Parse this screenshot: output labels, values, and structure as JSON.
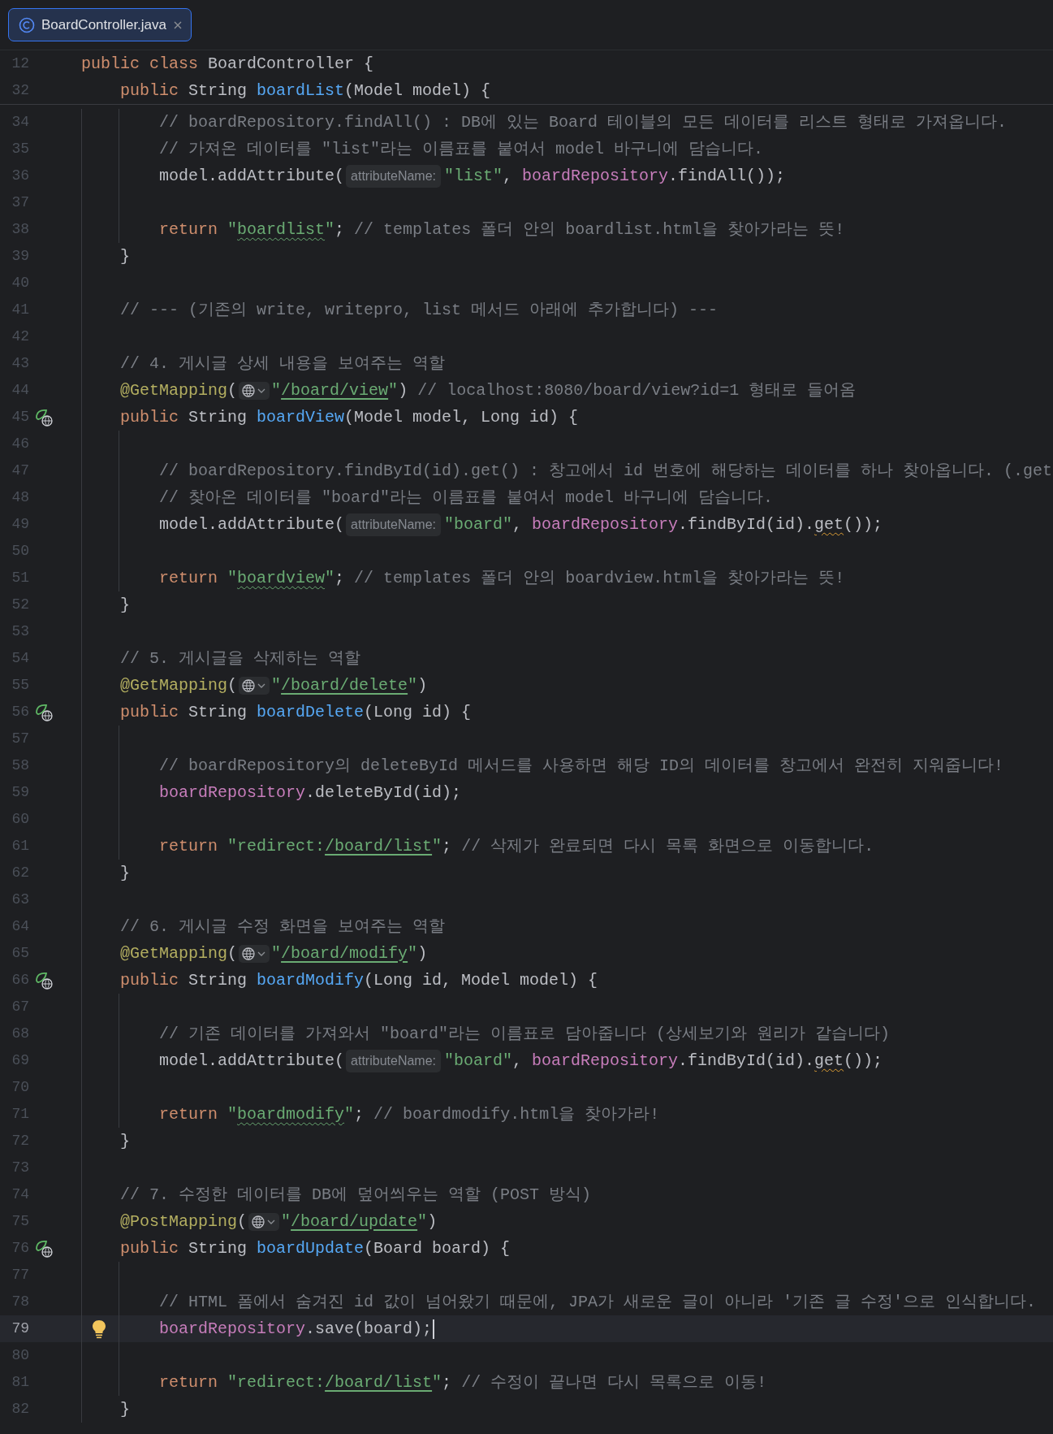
{
  "tab": {
    "label": "BoardController.java",
    "selected": true
  },
  "sticky_lines": [
    {
      "number": "12",
      "tokens": [
        {
          "kind": "keyword",
          "text": "public class"
        },
        {
          "kind": "plain",
          "text": " BoardController {"
        }
      ]
    },
    {
      "number": "32",
      "tokens": [
        {
          "kind": "keyword",
          "text": "    public"
        },
        {
          "kind": "plain",
          "text": " String "
        },
        {
          "kind": "method",
          "text": "boardList"
        },
        {
          "kind": "plain",
          "text": "(Model model) {"
        }
      ]
    }
  ],
  "lines": [
    {
      "number": "34",
      "current": false,
      "tokens": [
        {
          "kind": "comment",
          "text": "        // boardRepository.findAll() : DB에 있는 Board 테이블의 모든 데이터를 리스트 형태로 가져옵니다."
        }
      ]
    },
    {
      "number": "35",
      "current": false,
      "tokens": [
        {
          "kind": "comment",
          "text": "        // 가져온 데이터를 \"list\"라는 이름표를 붙여서 model 바구니에 담습니다."
        }
      ]
    },
    {
      "number": "36",
      "current": false,
      "tokens": [
        {
          "kind": "plain",
          "text": "        model.addAttribute("
        },
        {
          "kind": "hint",
          "text": "attributeName:"
        },
        {
          "kind": "string",
          "text": "\"list\""
        },
        {
          "kind": "plain",
          "text": ", "
        },
        {
          "kind": "field",
          "text": "boardRepository"
        },
        {
          "kind": "plain",
          "text": ".findAll());"
        }
      ]
    },
    {
      "number": "37",
      "current": false
    },
    {
      "number": "38",
      "current": false,
      "tokens": [
        {
          "kind": "keyword",
          "text": "        return"
        },
        {
          "kind": "string",
          "text": " \""
        },
        {
          "kind": "string-typo",
          "text": "boardlist"
        },
        {
          "kind": "string",
          "text": "\""
        },
        {
          "kind": "plain",
          "text": "; "
        },
        {
          "kind": "comment",
          "text": "// templates 폴더 안의 boardlist.html을 찾아가라는 뜻!"
        }
      ]
    },
    {
      "number": "39",
      "current": false,
      "tokens": [
        {
          "kind": "plain",
          "text": "    }"
        }
      ]
    },
    {
      "number": "40",
      "current": false
    },
    {
      "number": "41",
      "current": false,
      "tokens": [
        {
          "kind": "comment",
          "text": "    // --- (기존의 write, writepro, list 메서드 아래에 추가합니다) ---"
        }
      ]
    },
    {
      "number": "42",
      "current": false
    },
    {
      "number": "43",
      "current": false,
      "tokens": [
        {
          "kind": "comment",
          "text": "    // 4. 게시글 상세 내용을 보여주는 역할"
        }
      ]
    },
    {
      "number": "44",
      "current": false,
      "tokens": [
        {
          "kind": "annotation",
          "text": "    @GetMapping"
        },
        {
          "kind": "plain",
          "text": "("
        },
        {
          "kind": "url-inlay"
        },
        {
          "kind": "string",
          "text": "\""
        },
        {
          "kind": "link",
          "text": "/board/view"
        },
        {
          "kind": "string",
          "text": "\""
        },
        {
          "kind": "plain",
          "text": ") "
        },
        {
          "kind": "comment",
          "text": "// localhost:8080/board/view?id=1 형태로 들어옴"
        }
      ]
    },
    {
      "number": "45",
      "current": false,
      "gutter": {
        "kind": "endpoint"
      },
      "tokens": [
        {
          "kind": "keyword",
          "text": "    public"
        },
        {
          "kind": "plain",
          "text": " String "
        },
        {
          "kind": "method",
          "text": "boardView"
        },
        {
          "kind": "plain",
          "text": "(Model model, Long id) {"
        }
      ]
    },
    {
      "number": "46",
      "current": false
    },
    {
      "number": "47",
      "current": false,
      "tokens": [
        {
          "kind": "comment",
          "text": "        // boardRepository.findById(id).get() : 창고에서 id 번호에 해당하는 데이터를 하나 찾아옵니다. (.get"
        }
      ]
    },
    {
      "number": "48",
      "current": false,
      "tokens": [
        {
          "kind": "comment",
          "text": "        // 찾아온 데이터를 \"board\"라는 이름표를 붙여서 model 바구니에 담습니다."
        }
      ]
    },
    {
      "number": "49",
      "current": false,
      "tokens": [
        {
          "kind": "plain",
          "text": "        model.addAttribute("
        },
        {
          "kind": "hint",
          "text": "attributeName:"
        },
        {
          "kind": "string",
          "text": "\"board\""
        },
        {
          "kind": "plain",
          "text": ", "
        },
        {
          "kind": "field",
          "text": "boardRepository"
        },
        {
          "kind": "plain",
          "text": ".findById(id)."
        },
        {
          "kind": "warn",
          "text": "get"
        },
        {
          "kind": "plain",
          "text": "());"
        }
      ]
    },
    {
      "number": "50",
      "current": false
    },
    {
      "number": "51",
      "current": false,
      "tokens": [
        {
          "kind": "keyword",
          "text": "        return"
        },
        {
          "kind": "string",
          "text": " \""
        },
        {
          "kind": "string-typo",
          "text": "boardview"
        },
        {
          "kind": "string",
          "text": "\""
        },
        {
          "kind": "plain",
          "text": "; "
        },
        {
          "kind": "comment",
          "text": "// templates 폴더 안의 boardview.html을 찾아가라는 뜻!"
        }
      ]
    },
    {
      "number": "52",
      "current": false,
      "tokens": [
        {
          "kind": "plain",
          "text": "    }"
        }
      ]
    },
    {
      "number": "53",
      "current": false
    },
    {
      "number": "54",
      "current": false,
      "tokens": [
        {
          "kind": "comment",
          "text": "    // 5. 게시글을 삭제하는 역할"
        }
      ]
    },
    {
      "number": "55",
      "current": false,
      "tokens": [
        {
          "kind": "annotation",
          "text": "    @GetMapping"
        },
        {
          "kind": "plain",
          "text": "("
        },
        {
          "kind": "url-inlay"
        },
        {
          "kind": "string",
          "text": "\""
        },
        {
          "kind": "link",
          "text": "/board/delete"
        },
        {
          "kind": "string",
          "text": "\""
        },
        {
          "kind": "plain",
          "text": ")"
        }
      ]
    },
    {
      "number": "56",
      "current": false,
      "gutter": {
        "kind": "endpoint"
      },
      "tokens": [
        {
          "kind": "keyword",
          "text": "    public"
        },
        {
          "kind": "plain",
          "text": " String "
        },
        {
          "kind": "method",
          "text": "boardDelete"
        },
        {
          "kind": "plain",
          "text": "(Long id) {"
        }
      ]
    },
    {
      "number": "57",
      "current": false
    },
    {
      "number": "58",
      "current": false,
      "tokens": [
        {
          "kind": "comment",
          "text": "        // boardRepository의 deleteById 메서드를 사용하면 해당 ID의 데이터를 창고에서 완전히 지워줍니다!"
        }
      ]
    },
    {
      "number": "59",
      "current": false,
      "tokens": [
        {
          "kind": "field",
          "text": "        boardRepository"
        },
        {
          "kind": "plain",
          "text": ".deleteById(id);"
        }
      ]
    },
    {
      "number": "60",
      "current": false
    },
    {
      "number": "61",
      "current": false,
      "tokens": [
        {
          "kind": "keyword",
          "text": "        return"
        },
        {
          "kind": "string",
          "text": " \"redirect:"
        },
        {
          "kind": "link",
          "text": "/board/list"
        },
        {
          "kind": "string",
          "text": "\""
        },
        {
          "kind": "plain",
          "text": "; "
        },
        {
          "kind": "comment",
          "text": "// 삭제가 완료되면 다시 목록 화면으로 이동합니다."
        }
      ]
    },
    {
      "number": "62",
      "current": false,
      "tokens": [
        {
          "kind": "plain",
          "text": "    }"
        }
      ]
    },
    {
      "number": "63",
      "current": false
    },
    {
      "number": "64",
      "current": false,
      "tokens": [
        {
          "kind": "comment",
          "text": "    // 6. 게시글 수정 화면을 보여주는 역할"
        }
      ]
    },
    {
      "number": "65",
      "current": false,
      "tokens": [
        {
          "kind": "annotation",
          "text": "    @GetMapping"
        },
        {
          "kind": "plain",
          "text": "("
        },
        {
          "kind": "url-inlay"
        },
        {
          "kind": "string",
          "text": "\""
        },
        {
          "kind": "link",
          "text": "/board/modify"
        },
        {
          "kind": "string",
          "text": "\""
        },
        {
          "kind": "plain",
          "text": ")"
        }
      ]
    },
    {
      "number": "66",
      "current": false,
      "gutter": {
        "kind": "endpoint"
      },
      "tokens": [
        {
          "kind": "keyword",
          "text": "    public"
        },
        {
          "kind": "plain",
          "text": " String "
        },
        {
          "kind": "method",
          "text": "boardModify"
        },
        {
          "kind": "plain",
          "text": "(Long id, Model model) {"
        }
      ]
    },
    {
      "number": "67",
      "current": false
    },
    {
      "number": "68",
      "current": false,
      "tokens": [
        {
          "kind": "comment",
          "text": "        // 기존 데이터를 가져와서 \"board\"라는 이름표로 담아줍니다 (상세보기와 원리가 같습니다)"
        }
      ]
    },
    {
      "number": "69",
      "current": false,
      "tokens": [
        {
          "kind": "plain",
          "text": "        model.addAttribute("
        },
        {
          "kind": "hint",
          "text": "attributeName:"
        },
        {
          "kind": "string",
          "text": "\"board\""
        },
        {
          "kind": "plain",
          "text": ", "
        },
        {
          "kind": "field",
          "text": "boardRepository"
        },
        {
          "kind": "plain",
          "text": ".findById(id)."
        },
        {
          "kind": "warn",
          "text": "get"
        },
        {
          "kind": "plain",
          "text": "());"
        }
      ]
    },
    {
      "number": "70",
      "current": false
    },
    {
      "number": "71",
      "current": false,
      "tokens": [
        {
          "kind": "keyword",
          "text": "        return"
        },
        {
          "kind": "string",
          "text": " \""
        },
        {
          "kind": "string-typo",
          "text": "boardmodify"
        },
        {
          "kind": "string",
          "text": "\""
        },
        {
          "kind": "plain",
          "text": "; "
        },
        {
          "kind": "comment",
          "text": "// boardmodify.html을 찾아가라!"
        }
      ]
    },
    {
      "number": "72",
      "current": false,
      "tokens": [
        {
          "kind": "plain",
          "text": "    }"
        }
      ]
    },
    {
      "number": "73",
      "current": false
    },
    {
      "number": "74",
      "current": false,
      "tokens": [
        {
          "kind": "comment",
          "text": "    // 7. 수정한 데이터를 DB에 덮어씌우는 역할 (POST 방식)"
        }
      ]
    },
    {
      "number": "75",
      "current": false,
      "tokens": [
        {
          "kind": "annotation",
          "text": "    @PostMapping"
        },
        {
          "kind": "plain",
          "text": "("
        },
        {
          "kind": "url-inlay"
        },
        {
          "kind": "string",
          "text": "\""
        },
        {
          "kind": "link",
          "text": "/board/update"
        },
        {
          "kind": "string",
          "text": "\""
        },
        {
          "kind": "plain",
          "text": ")"
        }
      ]
    },
    {
      "number": "76",
      "current": false,
      "gutter": {
        "kind": "endpoint"
      },
      "tokens": [
        {
          "kind": "keyword",
          "text": "    public"
        },
        {
          "kind": "plain",
          "text": " String "
        },
        {
          "kind": "method",
          "text": "boardUpdate"
        },
        {
          "kind": "plain",
          "text": "(Board board) {"
        }
      ]
    },
    {
      "number": "77",
      "current": false
    },
    {
      "number": "78",
      "current": false,
      "tokens": [
        {
          "kind": "comment",
          "text": "        // HTML 폼에서 숨겨진 id 값이 넘어왔기 때문에, JPA가 새로운 글이 아니라 '기존 글 수정'으로 인식합니다."
        }
      ]
    },
    {
      "number": "79",
      "current": true,
      "gutter": {
        "kind": "bulb"
      },
      "tokens": [
        {
          "kind": "field",
          "text": "        boardRepository"
        },
        {
          "kind": "plain",
          "text": ".save(board);"
        }
      ]
    },
    {
      "number": "80",
      "current": false
    },
    {
      "number": "81",
      "current": false,
      "tokens": [
        {
          "kind": "keyword",
          "text": "        return"
        },
        {
          "kind": "string",
          "text": " \"redirect:"
        },
        {
          "kind": "link",
          "text": "/board/list"
        },
        {
          "kind": "string",
          "text": "\""
        },
        {
          "kind": "plain",
          "text": "; "
        },
        {
          "kind": "comment",
          "text": "// 수정이 끝나면 다시 목록으로 이동!"
        }
      ]
    },
    {
      "number": "82",
      "current": false,
      "tokens": [
        {
          "kind": "plain",
          "text": "    }"
        }
      ]
    }
  ]
}
